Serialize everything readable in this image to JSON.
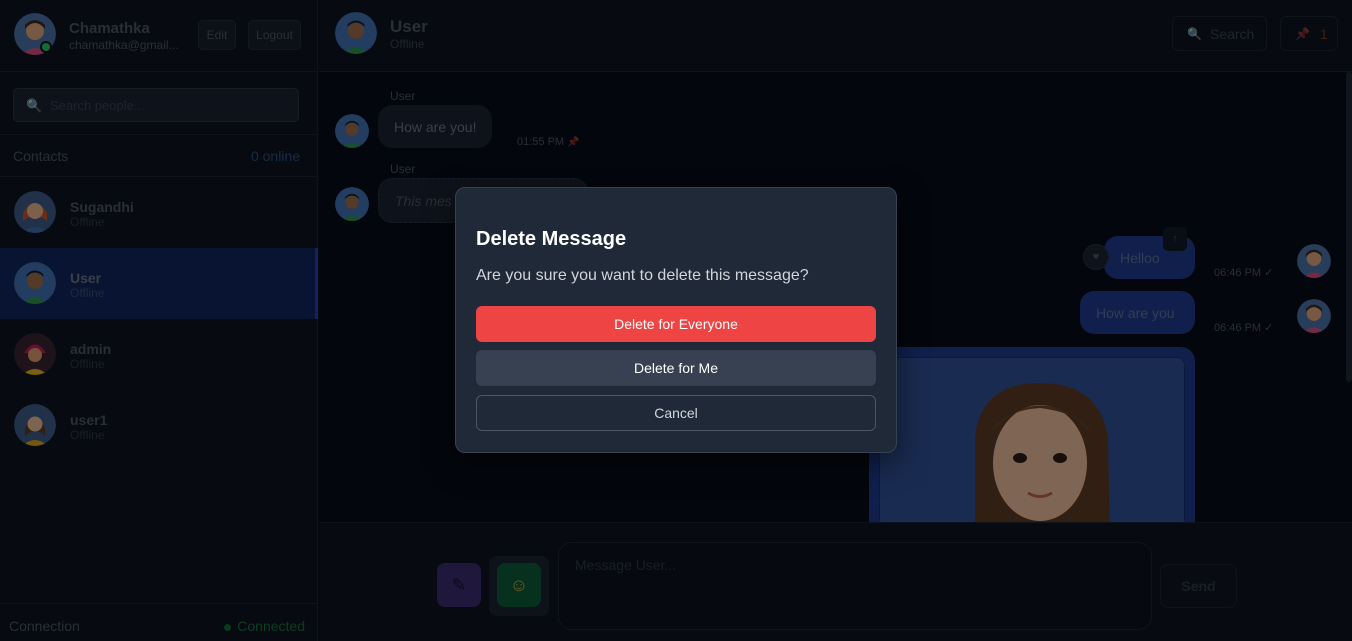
{
  "profile": {
    "name": "Chamathka",
    "email": "chamathka@gmail...",
    "edit_label": "Edit",
    "logout_label": "Logout"
  },
  "search": {
    "placeholder": "Search people..."
  },
  "contacts_header": {
    "label": "Contacts",
    "online": "0 online"
  },
  "contacts": [
    {
      "name": "Sugandhi",
      "status": "Offline"
    },
    {
      "name": "User",
      "status": "Offline",
      "active": true
    },
    {
      "name": "admin",
      "status": "Offline"
    },
    {
      "name": "user1",
      "status": "Offline"
    }
  ],
  "connection": {
    "label": "Connection",
    "status": "Connected"
  },
  "chat": {
    "name": "User",
    "status": "Offline",
    "search_label": "Search",
    "pin_count": "1"
  },
  "messages": [
    {
      "sender": "User",
      "text": "How are you!",
      "time": "01:55 PM"
    },
    {
      "sender": "User",
      "text": "This mes"
    },
    {
      "text": "Helloo",
      "time": "06:46 PM ✓"
    },
    {
      "text": "How are you",
      "time": "06:46 PM ✓"
    }
  ],
  "composer": {
    "placeholder": "Message User...",
    "send_label": "Send"
  },
  "modal": {
    "title": "Delete Message",
    "text": "Are you sure you want to delete this message?",
    "delete_everyone": "Delete for Everyone",
    "delete_me": "Delete for Me",
    "cancel": "Cancel"
  },
  "colors": {
    "accent": "#1e3a8a",
    "danger": "#ef4444",
    "online": "#22c55e"
  }
}
